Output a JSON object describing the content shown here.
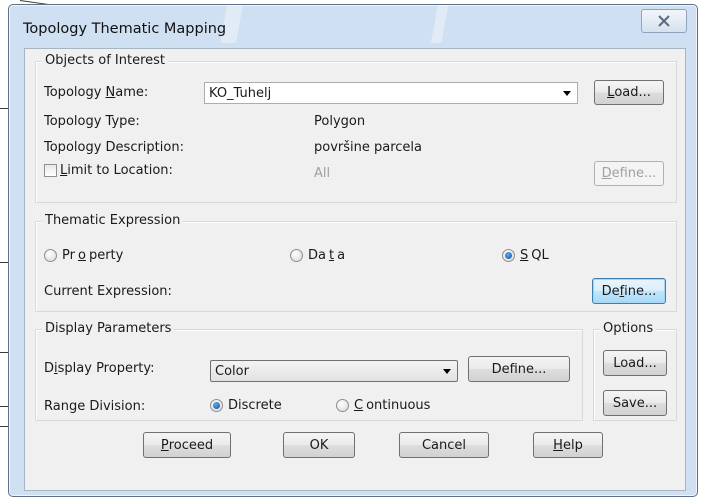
{
  "window": {
    "title": "Topology Thematic Mapping"
  },
  "objects_of_interest": {
    "legend": "Objects of Interest",
    "topology_name_label_pre": "Topology ",
    "topology_name_label_acc": "N",
    "topology_name_label_post": "ame:",
    "topology_name_value": "KO_Tuhelj",
    "load_button_acc": "L",
    "load_button_post": "oad...",
    "topology_type_label": "Topology Type:",
    "topology_type_value": "Polygon",
    "topology_description_label": "Topology Description:",
    "topology_description_value": "površine parcela",
    "limit_label_acc": "L",
    "limit_label_post": "imit to Location:",
    "limit_value": "All",
    "define_button_acc": "D",
    "define_button_post": "efine..."
  },
  "thematic_expression": {
    "legend": "Thematic Expression",
    "property_pre": "Pr",
    "property_acc": "o",
    "property_post": "perty",
    "data_pre": "Da",
    "data_acc": "t",
    "data_post": "a",
    "sql_acc": "S",
    "sql_post": "QL",
    "selected": "SQL",
    "current_expression_label": "Current Expression:",
    "define_button_pre": "De",
    "define_button_acc": "f",
    "define_button_post": "ine..."
  },
  "display_parameters": {
    "legend": "Display Parameters",
    "display_property_label_pre": "D",
    "display_property_label_acc": "i",
    "display_property_label_post": "splay Property:",
    "display_property_value": "Color",
    "define_button": "Define...",
    "range_division_label": "Range Division:",
    "discrete_label": "Discrete",
    "continuous_acc": "C",
    "continuous_post": "ontinuous",
    "selected": "Discrete"
  },
  "options": {
    "legend": "Options",
    "load_button": "Load...",
    "save_button": "Save..."
  },
  "footer": {
    "proceed_acc": "P",
    "proceed_post": "roceed",
    "ok": "OK",
    "cancel": "Cancel",
    "help_acc": "H",
    "help_post": "elp"
  },
  "icons": {
    "close": "close-icon",
    "dropdown": "chevron-down-icon"
  },
  "colors": {
    "window_frame": "#cfe0f2",
    "dialog_face": "#f0f0f0",
    "hot_button": "#bee6fd"
  }
}
